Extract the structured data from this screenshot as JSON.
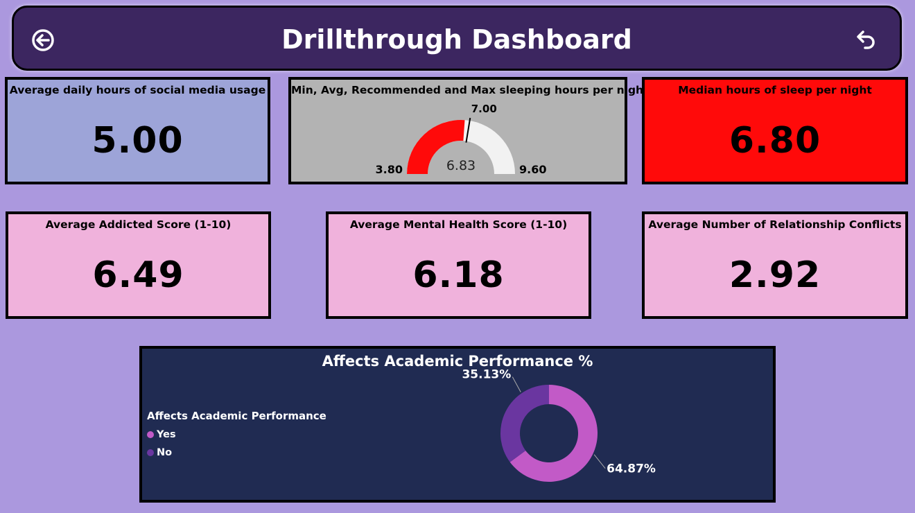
{
  "header": {
    "title": "Drillthrough Dashboard",
    "back_icon": "circle-arrow-left-icon",
    "reset_icon": "undo-arrow-icon"
  },
  "cards": {
    "social_media": {
      "title": "Average daily hours of social media usage",
      "value": "5.00"
    },
    "sleep_gauge": {
      "title": "Min, Avg, Recommended and Max sleeping hours per night",
      "min_label": "3.80",
      "max_label": "9.60",
      "avg_label": "6.83",
      "target_label": "7.00"
    },
    "median_sleep": {
      "title": "Median hours of sleep per night",
      "value": "6.80"
    },
    "addicted": {
      "title": "Average Addicted Score (1-10)",
      "value": "6.49"
    },
    "mental_health": {
      "title": "Average Mental Health Score (1-10)",
      "value": "6.18"
    },
    "conflicts": {
      "title": "Average Number of Relationship Conflicts",
      "value": "2.92"
    }
  },
  "colors": {
    "background": "#ab98de",
    "header": "#3c2660",
    "gauge_fill": "#ff0a0a",
    "gauge_track": "#f2f2f2",
    "yes": "#c25ac7",
    "no": "#6a36a0"
  },
  "academic": {
    "title": "Affects Academic Performance %",
    "legend_title": "Affects Academic Performance",
    "yes_label": "Yes",
    "no_label": "No",
    "yes_pct_label": "64.87%",
    "no_pct_label": "35.13%"
  },
  "chart_data": [
    {
      "type": "gauge",
      "title": "Min, Avg, Recommended and Max sleeping hours per night",
      "min": 3.8,
      "max": 9.6,
      "value": 6.83,
      "target": 7.0
    },
    {
      "type": "pie",
      "title": "Affects Academic Performance %",
      "categories": [
        "Yes",
        "No"
      ],
      "values": [
        64.87,
        35.13
      ],
      "legend": "left"
    }
  ]
}
